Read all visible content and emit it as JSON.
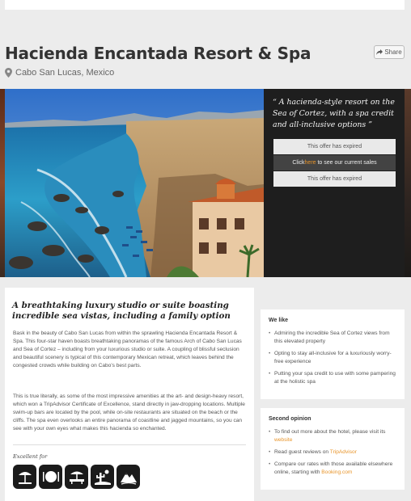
{
  "hotel": {
    "name": "Hacienda Encantada Resort & Spa",
    "location": "Cabo San Lucas, Mexico"
  },
  "share": {
    "label": "Share"
  },
  "offer": {
    "quote": "“ A hacienda-style resort on the Sea of Cortez, with a spa credit and all-inclusive options ”",
    "expired_1": "This offer has expired",
    "link_pre": "Click ",
    "link_here": "here",
    "link_post": " to see our current sales",
    "expired_2": "This offer has expired"
  },
  "description": {
    "headline": "A breathtaking luxury studio or suite boasting incredible sea vistas, including a family option",
    "para1": "Bask in the beauty of Cabo San Lucas from within the sprawling Hacienda Encantada Resort & Spa. This four-star haven boasts breathtaking panoramas of the famous Arch of Cabo San Lucas and Sea of Cortez – including from your luxurious studio or suite. A coupling of blissful seclusion and beautiful scenery is typical of this contemporary Mexican retreat, which leaves behind the congested crowds while building on Cabo's best parts.",
    "para2": "This is true literally, as some of the most impressive amenities at the art- and design-heavy resort, which won a TripAdvisor Certificate of Excellence, stand directly in jaw-dropping locations. Multiple swim-up bars are located by the pool, while on-site restaurants are situated on the beach or the cliffs. The spa even overlooks an entire panorama of coastline and jagged mountains, so you can see with your own eyes what makes this hacienda so enchanted.",
    "excellent_for": "Excellent for",
    "amenity_icons": [
      "beach-icon",
      "dining-icon",
      "spa-icon",
      "desert-icon",
      "mountain-icon"
    ]
  },
  "we_like": {
    "title": "We like",
    "items": [
      "Admiring the incredible Sea of Cortez views from this elevated property",
      "Opting to stay all-inclusive for a luxuriously worry-free experience",
      "Putting your spa credit to use with some pampering at the holistic spa"
    ]
  },
  "second_opinion": {
    "title": "Second opinion",
    "item1_pre": "To find out more about the hotel, please visit its ",
    "item1_link": "website",
    "item2_pre": "Read guest reviews on ",
    "item2_link": "TripAdvisor",
    "item3_pre": "Compare our rates with those available elsewhere online, starting with ",
    "item3_link": "Booking.com"
  },
  "colors": {
    "accent": "#e8952b",
    "panel": "#1e1e1e",
    "background": "#ececec"
  }
}
